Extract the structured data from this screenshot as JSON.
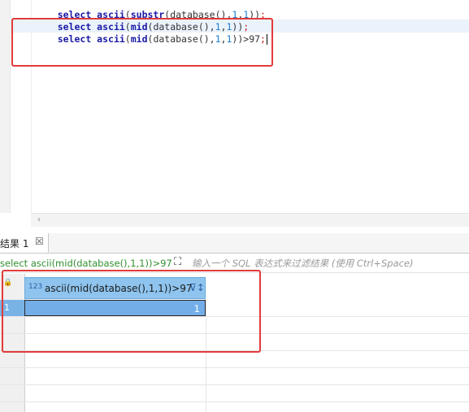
{
  "editor": {
    "lines": [
      {
        "kw": "select ",
        "fn": "ascii",
        "p1": "(",
        "fn2": "substr",
        "p2": "(database(),",
        "n1": "1",
        "c1": ",",
        "n2": "1",
        "p3": "))",
        "semi": ";"
      },
      {
        "kw": "select ",
        "fn": "ascii",
        "p1": "(",
        "fn2": "mid",
        "p2": "(database(),",
        "n1": "1",
        "c1": ",",
        "n2": "1",
        "p3": "))",
        "semi": ";"
      },
      {
        "kw": "select ",
        "fn": "ascii",
        "p1": "(",
        "fn2": "mid",
        "p2": "(database(),",
        "n1": "1",
        "c1": ",",
        "n2": "1",
        "p3": "))>97",
        "semi": ";"
      }
    ],
    "scroll_left_arrow": "‹"
  },
  "results_tab": {
    "label": "结果 1",
    "close": "☒"
  },
  "filter": {
    "query": "select ascii(mid(database(),1,1))>97",
    "icon": "⛶",
    "placeholder": "输入一个 SQL 表达式来过滤结果 (使用 Ctrl+Space)"
  },
  "grid": {
    "lock_icon": "🔒",
    "column": {
      "type_badge": "123",
      "name": "ascii(mid(database(),1,1))>97",
      "sort_icon": "⊽↕"
    },
    "rows": [
      {
        "num": "1",
        "value": "1"
      }
    ]
  },
  "colors": {
    "annotation": "#e23b3b",
    "header_bg": "#8ec4ee",
    "selected_cell": "#73aee8",
    "filter_text": "#2f8f2f"
  }
}
